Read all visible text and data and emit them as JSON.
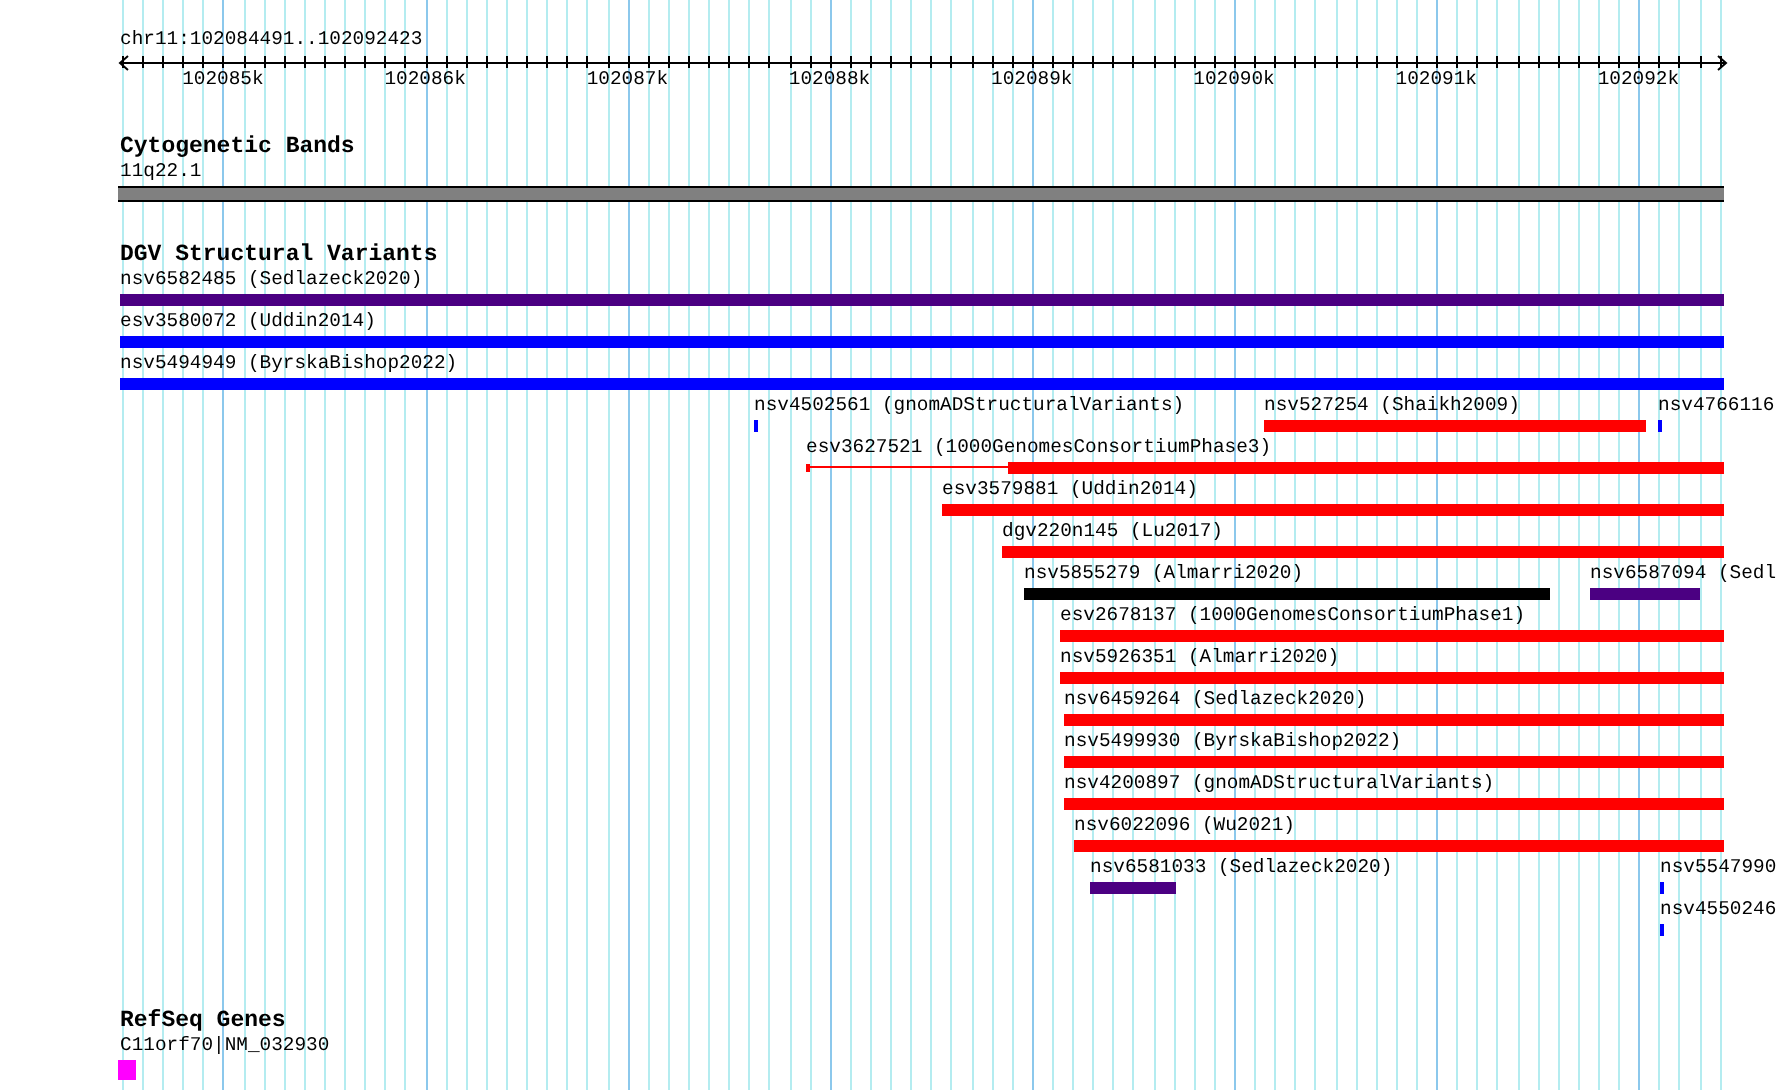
{
  "ruler": {
    "location": "chr11:102084491..102092423",
    "ticks": [
      "102085k",
      "102086k",
      "102087k",
      "102088k",
      "102089k",
      "102090k",
      "102091k",
      "102092k"
    ]
  },
  "tracks": [
    {
      "kind": "bands",
      "title": "Cytogenetic Bands",
      "features": [
        {
          "label": "11q22.1",
          "color": "#808080"
        }
      ]
    },
    {
      "kind": "variants",
      "title": "DGV Structural Variants",
      "features": [
        {
          "label": "nsv6582485 (Sedlazeck2020)",
          "color": "#4b0082",
          "kind": "bar"
        },
        {
          "label": "esv3580072 (Uddin2014)",
          "color": "#0000ff",
          "kind": "bar"
        },
        {
          "label": "nsv5494949 (ByrskaBishop2022)",
          "color": "#0000ff",
          "kind": "bar"
        },
        {
          "label": "nsv4502561 (gnomADStructuralVariants)",
          "color": "#0000ff",
          "kind": "bar"
        },
        {
          "label": "nsv527254 (Shaikh2009)",
          "color": "#ff0000",
          "kind": "bar"
        },
        {
          "label": "nsv4766116",
          "color": "#0000ff",
          "kind": "bar"
        },
        {
          "label": "esv3627521 (1000GenomesConsortiumPhase3)",
          "color": "#ff0000",
          "kind": "thin_thick"
        },
        {
          "label": "esv3579881 (Uddin2014)",
          "color": "#ff0000",
          "kind": "bar"
        },
        {
          "label": "dgv220n145 (Lu2017)",
          "color": "#ff0000",
          "kind": "bar"
        },
        {
          "label": "nsv5855279 (Almarri2020)",
          "color": "#000000",
          "kind": "bar"
        },
        {
          "label": "nsv6587094 (Sedl",
          "color": "#4b0082",
          "kind": "bar"
        },
        {
          "label": "esv2678137 (1000GenomesConsortiumPhase1)",
          "color": "#ff0000",
          "kind": "bar"
        },
        {
          "label": "nsv5926351 (Almarri2020)",
          "color": "#ff0000",
          "kind": "bar"
        },
        {
          "label": "nsv6459264 (Sedlazeck2020)",
          "color": "#ff0000",
          "kind": "bar"
        },
        {
          "label": "nsv5499930 (ByrskaBishop2022)",
          "color": "#ff0000",
          "kind": "bar"
        },
        {
          "label": "nsv4200897 (gnomADStructuralVariants)",
          "color": "#ff0000",
          "kind": "bar"
        },
        {
          "label": "nsv6022096 (Wu2021)",
          "color": "#ff0000",
          "kind": "bar"
        },
        {
          "label": "nsv6581033 (Sedlazeck2020)",
          "color": "#4b0082",
          "kind": "bar"
        },
        {
          "label": "nsv5547990",
          "color": "#0000ff",
          "kind": "bar"
        },
        {
          "label": "nsv4550246",
          "color": "#0000ff",
          "kind": "bar"
        }
      ]
    },
    {
      "kind": "genes",
      "title": "RefSeq Genes",
      "features": [
        {
          "label": "C11orf70|NM_032930",
          "color": "#ff00ff"
        }
      ]
    }
  ]
}
